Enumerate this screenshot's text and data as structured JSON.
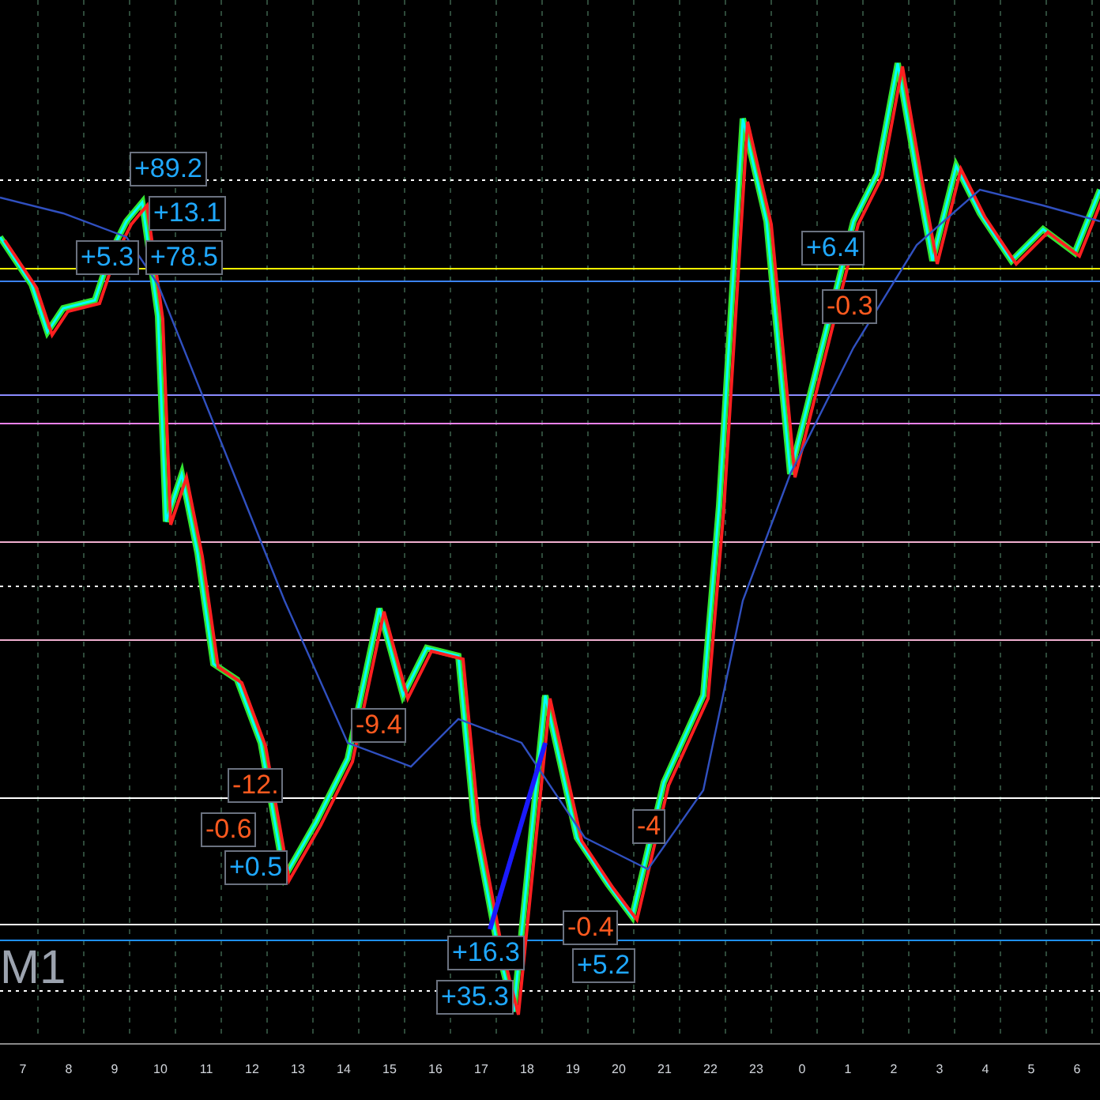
{
  "timeframe": "M1",
  "trade_labels": [
    {
      "text": "+89.2",
      "kind": "profit"
    },
    {
      "text": "+13.1",
      "kind": "profit"
    },
    {
      "text": "+5.3",
      "kind": "profit"
    },
    {
      "text": "+78.5",
      "kind": "profit"
    },
    {
      "text": "-9.4",
      "kind": "loss"
    },
    {
      "text": "-12.",
      "kind": "loss"
    },
    {
      "text": "-0.6",
      "kind": "loss"
    },
    {
      "text": "+0.5",
      "kind": "profit"
    },
    {
      "text": "+16.3",
      "kind": "profit"
    },
    {
      "text": "+35.3",
      "kind": "profit"
    },
    {
      "text": "-0.4",
      "kind": "loss"
    },
    {
      "text": "+5.2",
      "kind": "profit"
    },
    {
      "text": "-4",
      "kind": "loss"
    },
    {
      "text": "+6.4",
      "kind": "profit"
    },
    {
      "text": "-0.3",
      "kind": "loss"
    }
  ],
  "time_axis": [
    "7",
    "8",
    "9",
    "10",
    "11",
    "12",
    "13",
    "14",
    "15",
    "16",
    "17",
    "18",
    "19",
    "20",
    "21",
    "22",
    "23",
    "0",
    "1",
    "2",
    "3",
    "4",
    "5",
    "6"
  ]
}
